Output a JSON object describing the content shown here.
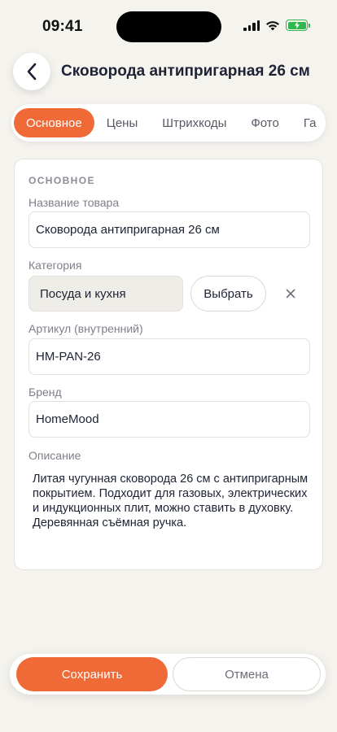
{
  "status_bar": {
    "time": "09:41"
  },
  "header": {
    "back_icon": "chevron-left-icon",
    "title": "Сковорода антипригарная 26 см"
  },
  "tabs": [
    {
      "label": "Основное",
      "active": true
    },
    {
      "label": "Цены",
      "active": false
    },
    {
      "label": "Штрихкоды",
      "active": false
    },
    {
      "label": "Фото",
      "active": false
    },
    {
      "label": "Га",
      "active": false
    }
  ],
  "section": {
    "title": "ОСНОВНОЕ",
    "name_label": "Название товара",
    "name_value": "Сковорода антипригарная 26 см",
    "category_label": "Категория",
    "category_value": "Посуда и кухня",
    "choose_button": "Выбрать",
    "sku_label": "Артикул (внутренний)",
    "sku_value": "HM-PAN-26",
    "brand_label": "Бренд",
    "brand_value": "HomeMood",
    "description_label": "Описание",
    "description_value": "Литая чугунная сковорода 26 см с антипригарным покрытием. Подходит для газовых, электрических и индукционных плит, можно ставить в духовку. Деревянная съёмная ручка."
  },
  "actions": {
    "save": "Сохранить",
    "cancel": "Отмена"
  },
  "colors": {
    "accent": "#f06a38",
    "background": "#f5f3ee",
    "battery": "#2fb84d"
  }
}
